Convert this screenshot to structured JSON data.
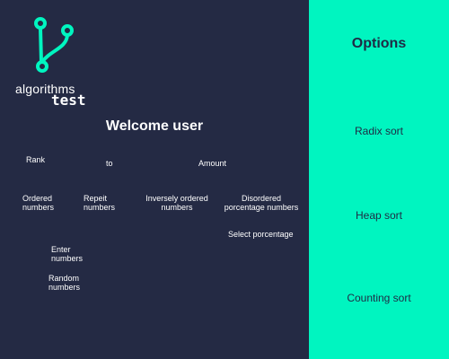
{
  "logo": {
    "word": "algorithms",
    "sub": "test",
    "icon": "git-branch-icon",
    "color": "#00f5c0"
  },
  "header": {
    "welcome": "Welcome user"
  },
  "filters": {
    "rank_label": "Rank",
    "to_label": "to",
    "amount_label": "Amount"
  },
  "types": {
    "ordered": "Ordered numbers",
    "repeit": "Repeit numbers",
    "inversely": "Inversely ordered numbers",
    "disordered": "Disordered porcentage numbers",
    "enter": "Enter numbers",
    "random": "Random numbers",
    "select_percentage": "Select porcentage"
  },
  "options": {
    "title": "Options",
    "items": [
      "Radix sort",
      "Heap sort",
      "Counting sort"
    ]
  },
  "colors": {
    "background_left": "#242a44",
    "background_right": "#00f5c0",
    "text_dark": "#1f2a44",
    "text_light": "#ffffff"
  }
}
